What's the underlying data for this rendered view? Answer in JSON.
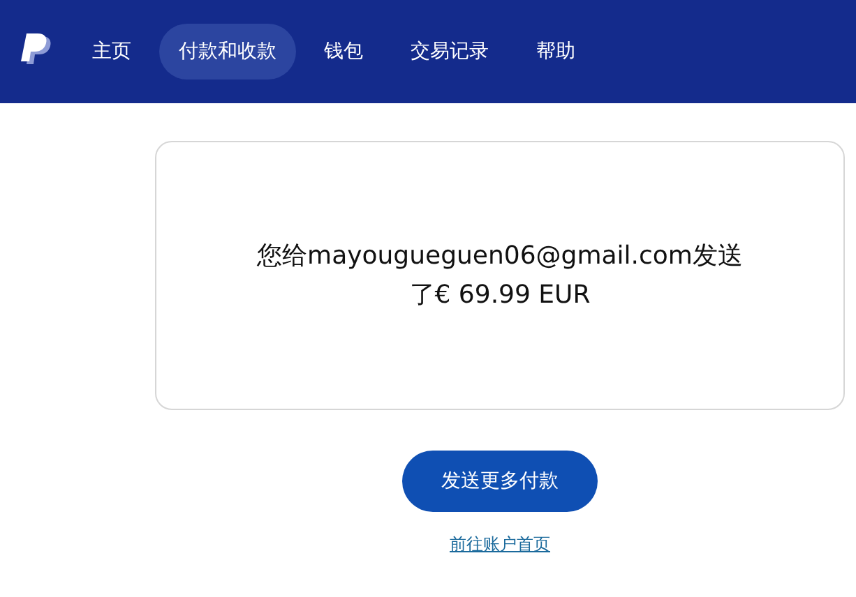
{
  "nav": {
    "items": [
      {
        "label": "主页",
        "selected": false
      },
      {
        "label": "付款和收款",
        "selected": true
      },
      {
        "label": "钱包",
        "selected": false
      },
      {
        "label": "交易记录",
        "selected": false
      },
      {
        "label": "帮助",
        "selected": false
      }
    ]
  },
  "confirmation": {
    "message_lines": [
      "您给mayougueguen06@gmail.com发送",
      "了€ 69.99 EUR"
    ]
  },
  "actions": {
    "primary_button": "发送更多付款",
    "link": "前往账户首页"
  }
}
